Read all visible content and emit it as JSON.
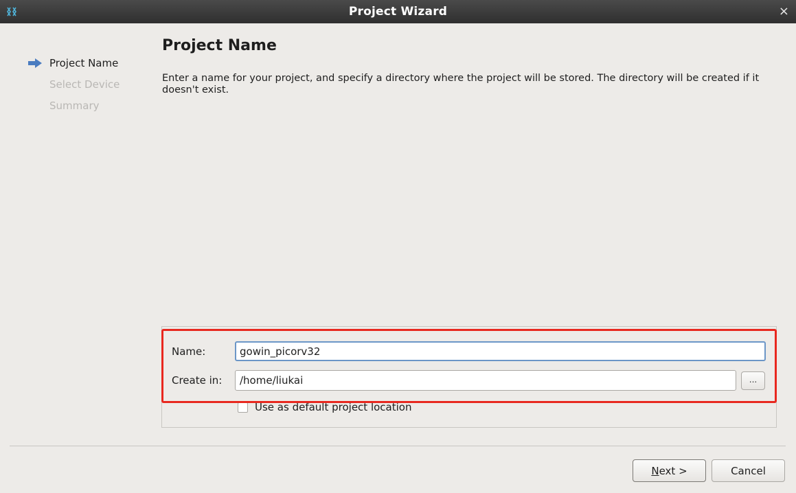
{
  "window": {
    "title": "Project Wizard",
    "close_glyph": "×",
    "icon": "gowin-logo-icon"
  },
  "steps": [
    {
      "label": "Project Name",
      "state": "active",
      "icon": "arrow-right-icon"
    },
    {
      "label": "Select Device",
      "state": "inactive"
    },
    {
      "label": "Summary",
      "state": "inactive"
    }
  ],
  "page": {
    "heading": "Project Name",
    "description": "Enter a name for your project, and specify a directory where the project will be stored. The directory will be created if it doesn't exist."
  },
  "form": {
    "name_label": "Name:",
    "name_value": "gowin_picorv32",
    "create_in_label": "Create in:",
    "create_in_value": "/home/liukai",
    "browse_label": "...",
    "default_location_label": "Use as default project location",
    "default_location_checked": false
  },
  "buttons": {
    "next_mnemonic": "N",
    "next_rest": "ext >",
    "cancel": "Cancel"
  },
  "colors": {
    "highlight": "#e8281f",
    "titlebar": "#3a3a3a",
    "step_arrow": "#4a7cc0",
    "focus_border": "#6b96c7"
  }
}
